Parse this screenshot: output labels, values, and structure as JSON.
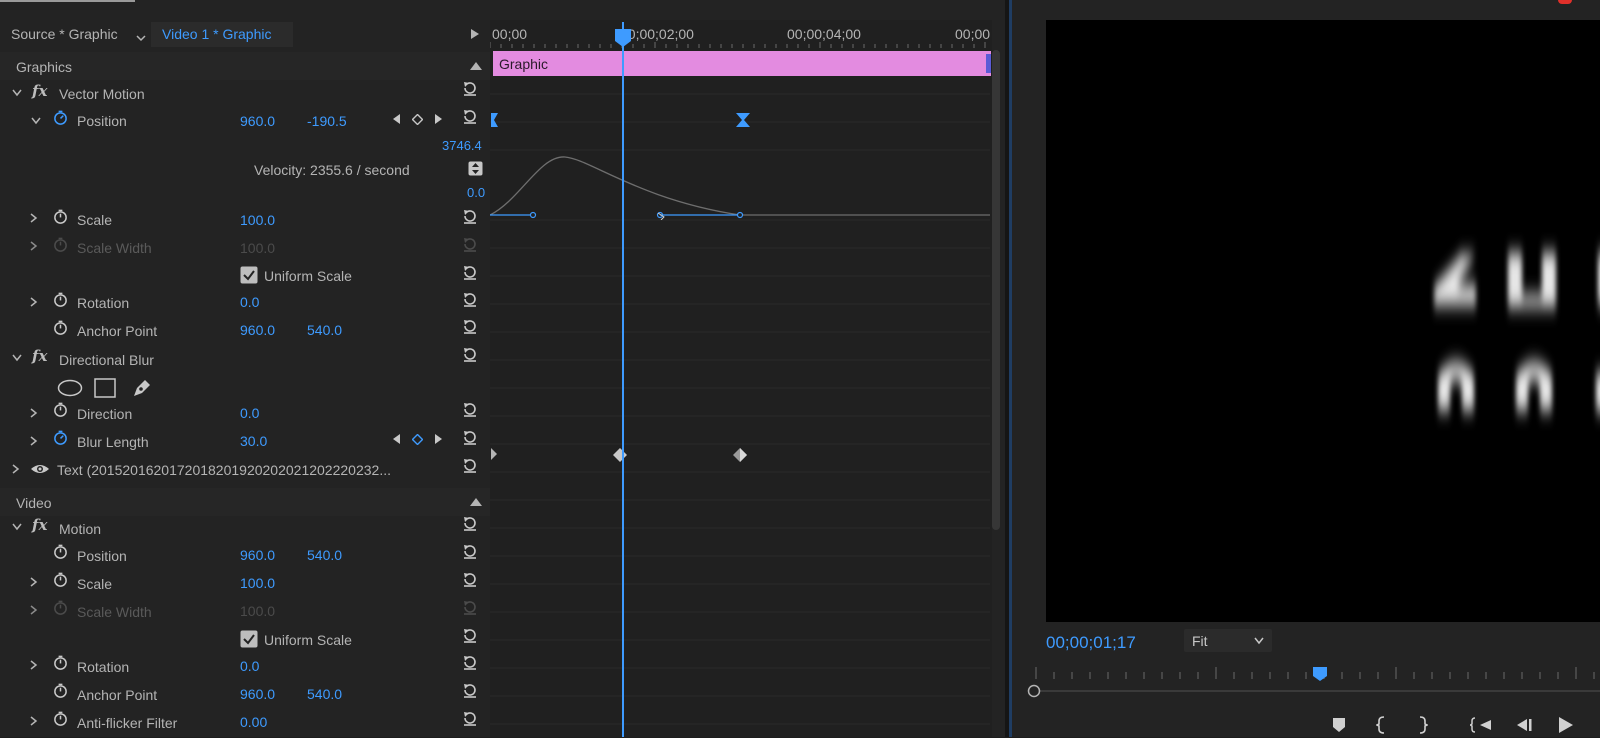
{
  "tabs": {
    "source": "Source * Graphic",
    "active": "Video 1 * Graphic"
  },
  "timeline": {
    "ruler": [
      "00;00",
      "00;00;02;00",
      "00;00;04;00",
      "00;00"
    ],
    "clip_label": "Graphic",
    "clip_color": "#e38be0",
    "graph_max": "3746.4",
    "graph_min": "0.0"
  },
  "graphics_section": {
    "title": "Graphics",
    "vector_motion": {
      "name": "Vector Motion",
      "position": {
        "label": "Position",
        "x": "960.0",
        "y": "-190.5"
      },
      "velocity": "Velocity: 2355.6 / second",
      "scale": {
        "label": "Scale",
        "value": "100.0"
      },
      "scale_width": {
        "label": "Scale Width",
        "value": "100.0"
      },
      "uniform_scale": "Uniform Scale",
      "rotation": {
        "label": "Rotation",
        "value": "0.0"
      },
      "anchor": {
        "label": "Anchor Point",
        "x": "960.0",
        "y": "540.0"
      }
    },
    "directional_blur": {
      "name": "Directional Blur",
      "direction": {
        "label": "Direction",
        "value": "0.0"
      },
      "blur_length": {
        "label": "Blur Length",
        "value": "30.0"
      }
    },
    "text_layer": "Text (2015201620172018201920202021202220232..."
  },
  "video_section": {
    "title": "Video",
    "motion": {
      "name": "Motion",
      "position": {
        "label": "Position",
        "x": "960.0",
        "y": "540.0"
      },
      "scale": {
        "label": "Scale",
        "value": "100.0"
      },
      "scale_width": {
        "label": "Scale Width",
        "value": "100.0"
      },
      "uniform_scale": "Uniform Scale",
      "rotation": {
        "label": "Rotation",
        "value": "0.0"
      },
      "anchor": {
        "label": "Anchor Point",
        "x": "960.0",
        "y": "540.0"
      },
      "anti_flicker": {
        "label": "Anti-flicker Filter",
        "value": "0.00"
      }
    }
  },
  "monitor": {
    "timecode": "00;00;01;17",
    "zoom": "Fit"
  },
  "colors": {
    "accent": "#3e9bff",
    "panel_bg": "#232323",
    "clip": "#e38be0"
  }
}
